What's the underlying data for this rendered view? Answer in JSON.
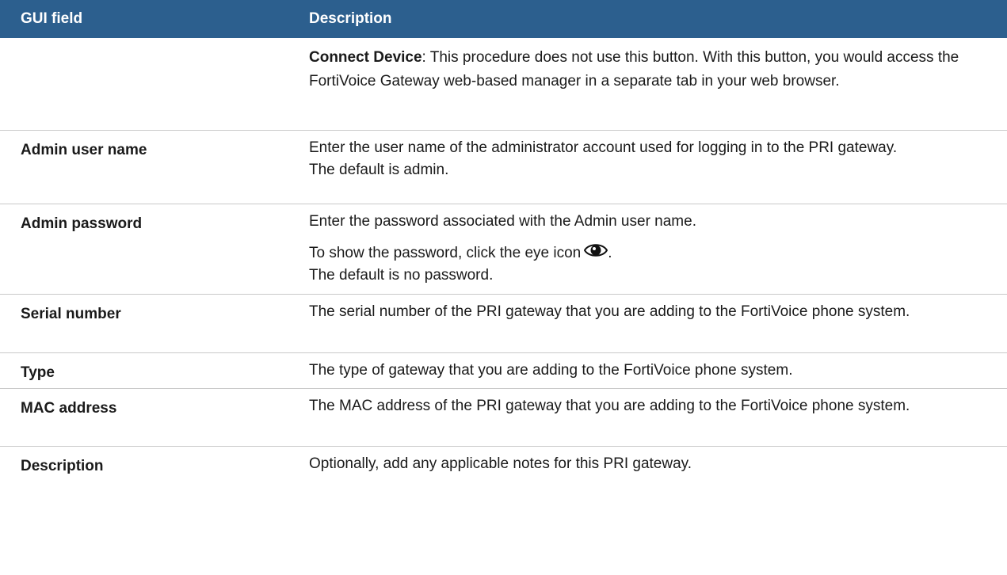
{
  "header": {
    "col1": "GUI field",
    "col2": "Description"
  },
  "rows": [
    {
      "field": "",
      "lines": [
        {
          "bold": "Connect Device",
          "text": ": This procedure does not use this button. With this button, you would access the FortiVoice Gateway web-based manager in a separate tab in your web browser."
        }
      ]
    },
    {
      "field": "Admin user name",
      "lines": [
        "Enter the user name of the administrator account used for logging in to the PRI gateway.",
        "The default is admin."
      ]
    },
    {
      "field": "Admin password",
      "lines": [
        "Enter the password associated with the Admin user name.",
        "To show the password, click the eye icon",
        "The default is no password."
      ]
    },
    {
      "field": "Serial number",
      "lines": [
        "The serial number of the PRI gateway that you are adding to the FortiVoice phone system."
      ]
    },
    {
      "field": "Type",
      "lines": [
        "The type of gateway that you are adding to the FortiVoice phone system."
      ]
    },
    {
      "field": "MAC address",
      "lines": [
        "The MAC address of the PRI gateway that you are adding to the FortiVoice phone system."
      ]
    },
    {
      "field": "Description",
      "lines": [
        "Optionally, add any applicable notes for this PRI gateway."
      ]
    }
  ],
  "icons": {
    "eye": "eye-icon"
  },
  "colors": {
    "header_bg": "#2c5f8e",
    "header_text": "#ffffff",
    "row_border": "#c9c9c9"
  }
}
